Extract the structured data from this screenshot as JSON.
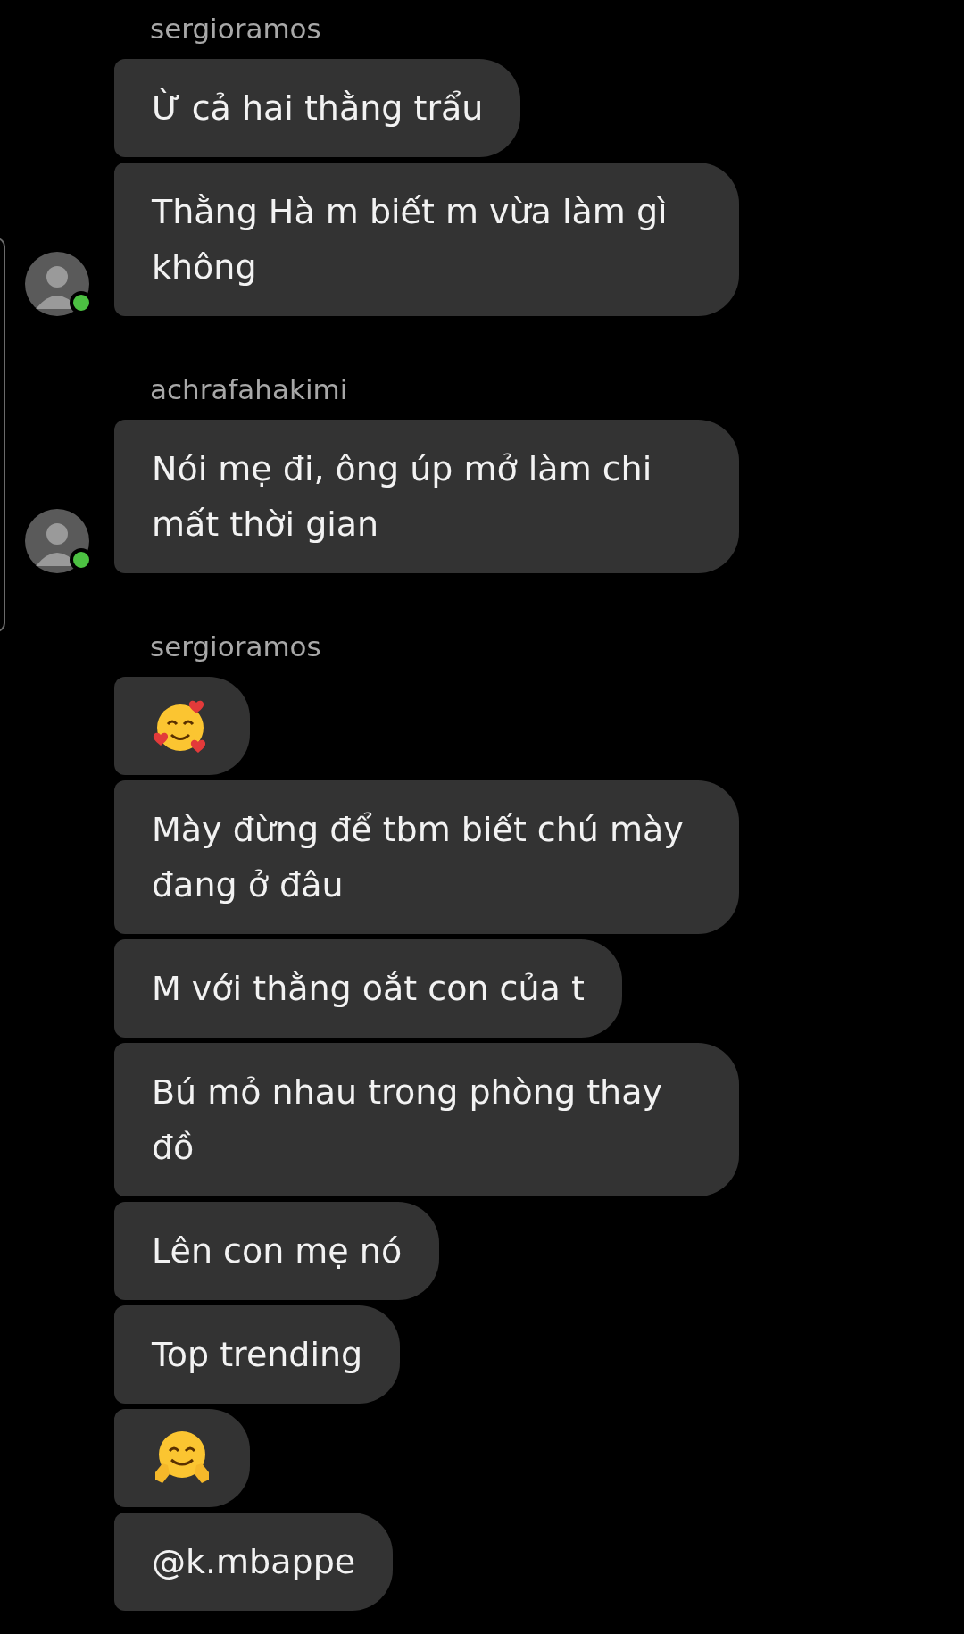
{
  "groups": [
    {
      "username": "sergioramos",
      "avatar": {
        "online": true
      },
      "messages": [
        {
          "kind": "text",
          "text": "Ừ cả hai thằng trẩu"
        },
        {
          "kind": "text",
          "text": "Thằng Hà m biết m vừa làm gì không"
        }
      ]
    },
    {
      "username": "achrafahakimi",
      "avatar": {
        "online": true
      },
      "messages": [
        {
          "kind": "text",
          "text": "Nói mẹ đi, ông úp mở làm chi mất thời gian"
        }
      ]
    },
    {
      "username": "sergioramos",
      "messages": [
        {
          "kind": "love"
        },
        {
          "kind": "text",
          "text": "Mày đừng để tbm biết chú mày đang ở đâu"
        },
        {
          "kind": "text",
          "text": "M với thằng oắt con của t"
        },
        {
          "kind": "text",
          "text": "Bú mỏ nhau trong phòng thay đồ"
        },
        {
          "kind": "text",
          "text": "Lên con mẹ nó"
        },
        {
          "kind": "text",
          "text": "Top trending"
        },
        {
          "kind": "hug"
        },
        {
          "kind": "text",
          "text": "@k.mbappe"
        }
      ]
    }
  ]
}
